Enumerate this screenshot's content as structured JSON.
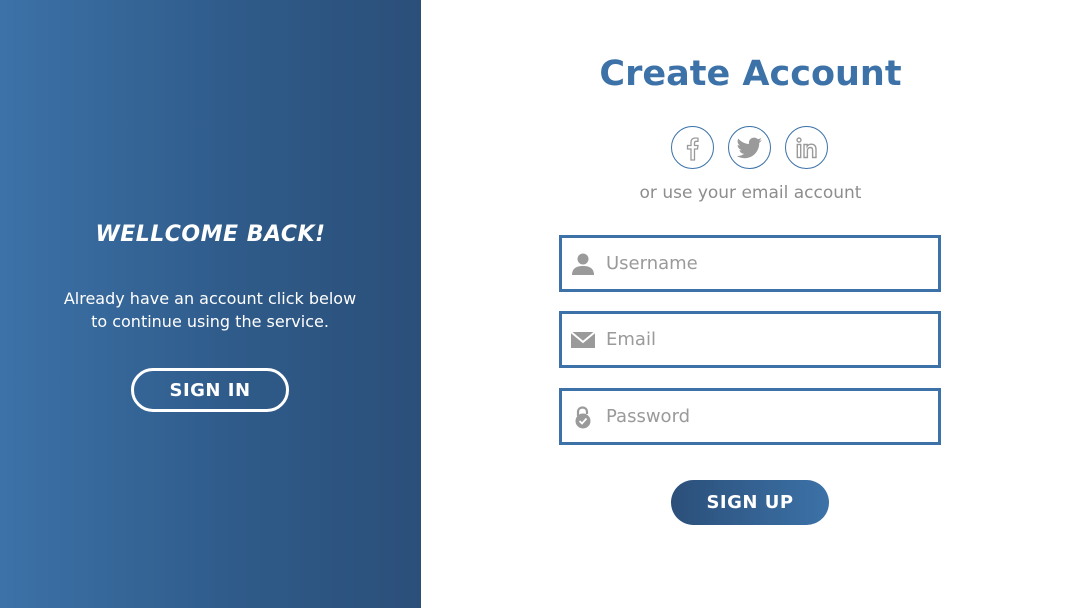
{
  "welcome": {
    "title": "Wellcome Back!",
    "text": "Already have an account click below to continue using the service.",
    "signin_label": "SIGN IN"
  },
  "form": {
    "title": "Create Account",
    "social": [
      "facebook-icon",
      "twitter-icon",
      "linkedin-icon"
    ],
    "alt_text": "or use your email account",
    "username_placeholder": "Username",
    "email_placeholder": "Email",
    "password_placeholder": "Password",
    "signup_label": "SIGN UP"
  },
  "colors": {
    "accent": "#3c72a8",
    "panel_dark": "#2b4f79",
    "muted_text": "#8d8d8d"
  }
}
